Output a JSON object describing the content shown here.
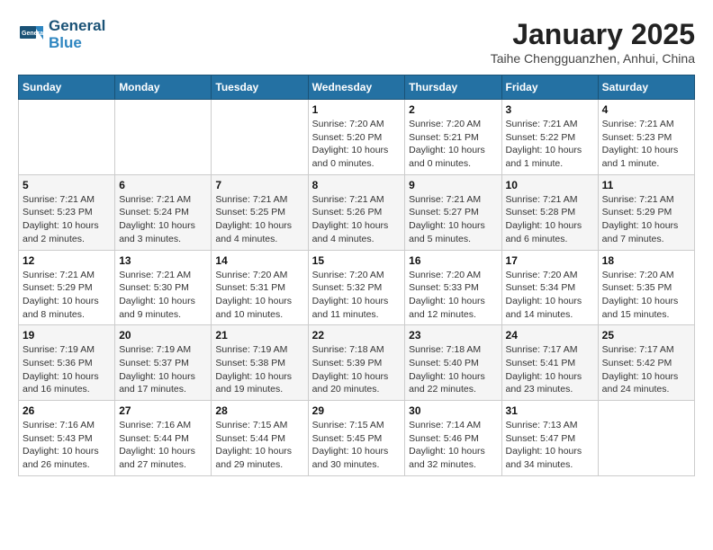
{
  "logo": {
    "line1": "General",
    "line2": "Blue"
  },
  "title": "January 2025",
  "subtitle": "Taihe Chengguanzhen, Anhui, China",
  "days_of_week": [
    "Sunday",
    "Monday",
    "Tuesday",
    "Wednesday",
    "Thursday",
    "Friday",
    "Saturday"
  ],
  "weeks": [
    [
      {
        "day": "",
        "info": ""
      },
      {
        "day": "",
        "info": ""
      },
      {
        "day": "",
        "info": ""
      },
      {
        "day": "1",
        "info": "Sunrise: 7:20 AM\nSunset: 5:20 PM\nDaylight: 10 hours\nand 0 minutes."
      },
      {
        "day": "2",
        "info": "Sunrise: 7:20 AM\nSunset: 5:21 PM\nDaylight: 10 hours\nand 0 minutes."
      },
      {
        "day": "3",
        "info": "Sunrise: 7:21 AM\nSunset: 5:22 PM\nDaylight: 10 hours\nand 1 minute."
      },
      {
        "day": "4",
        "info": "Sunrise: 7:21 AM\nSunset: 5:23 PM\nDaylight: 10 hours\nand 1 minute."
      }
    ],
    [
      {
        "day": "5",
        "info": "Sunrise: 7:21 AM\nSunset: 5:23 PM\nDaylight: 10 hours\nand 2 minutes."
      },
      {
        "day": "6",
        "info": "Sunrise: 7:21 AM\nSunset: 5:24 PM\nDaylight: 10 hours\nand 3 minutes."
      },
      {
        "day": "7",
        "info": "Sunrise: 7:21 AM\nSunset: 5:25 PM\nDaylight: 10 hours\nand 4 minutes."
      },
      {
        "day": "8",
        "info": "Sunrise: 7:21 AM\nSunset: 5:26 PM\nDaylight: 10 hours\nand 4 minutes."
      },
      {
        "day": "9",
        "info": "Sunrise: 7:21 AM\nSunset: 5:27 PM\nDaylight: 10 hours\nand 5 minutes."
      },
      {
        "day": "10",
        "info": "Sunrise: 7:21 AM\nSunset: 5:28 PM\nDaylight: 10 hours\nand 6 minutes."
      },
      {
        "day": "11",
        "info": "Sunrise: 7:21 AM\nSunset: 5:29 PM\nDaylight: 10 hours\nand 7 minutes."
      }
    ],
    [
      {
        "day": "12",
        "info": "Sunrise: 7:21 AM\nSunset: 5:29 PM\nDaylight: 10 hours\nand 8 minutes."
      },
      {
        "day": "13",
        "info": "Sunrise: 7:21 AM\nSunset: 5:30 PM\nDaylight: 10 hours\nand 9 minutes."
      },
      {
        "day": "14",
        "info": "Sunrise: 7:20 AM\nSunset: 5:31 PM\nDaylight: 10 hours\nand 10 minutes."
      },
      {
        "day": "15",
        "info": "Sunrise: 7:20 AM\nSunset: 5:32 PM\nDaylight: 10 hours\nand 11 minutes."
      },
      {
        "day": "16",
        "info": "Sunrise: 7:20 AM\nSunset: 5:33 PM\nDaylight: 10 hours\nand 12 minutes."
      },
      {
        "day": "17",
        "info": "Sunrise: 7:20 AM\nSunset: 5:34 PM\nDaylight: 10 hours\nand 14 minutes."
      },
      {
        "day": "18",
        "info": "Sunrise: 7:20 AM\nSunset: 5:35 PM\nDaylight: 10 hours\nand 15 minutes."
      }
    ],
    [
      {
        "day": "19",
        "info": "Sunrise: 7:19 AM\nSunset: 5:36 PM\nDaylight: 10 hours\nand 16 minutes."
      },
      {
        "day": "20",
        "info": "Sunrise: 7:19 AM\nSunset: 5:37 PM\nDaylight: 10 hours\nand 17 minutes."
      },
      {
        "day": "21",
        "info": "Sunrise: 7:19 AM\nSunset: 5:38 PM\nDaylight: 10 hours\nand 19 minutes."
      },
      {
        "day": "22",
        "info": "Sunrise: 7:18 AM\nSunset: 5:39 PM\nDaylight: 10 hours\nand 20 minutes."
      },
      {
        "day": "23",
        "info": "Sunrise: 7:18 AM\nSunset: 5:40 PM\nDaylight: 10 hours\nand 22 minutes."
      },
      {
        "day": "24",
        "info": "Sunrise: 7:17 AM\nSunset: 5:41 PM\nDaylight: 10 hours\nand 23 minutes."
      },
      {
        "day": "25",
        "info": "Sunrise: 7:17 AM\nSunset: 5:42 PM\nDaylight: 10 hours\nand 24 minutes."
      }
    ],
    [
      {
        "day": "26",
        "info": "Sunrise: 7:16 AM\nSunset: 5:43 PM\nDaylight: 10 hours\nand 26 minutes."
      },
      {
        "day": "27",
        "info": "Sunrise: 7:16 AM\nSunset: 5:44 PM\nDaylight: 10 hours\nand 27 minutes."
      },
      {
        "day": "28",
        "info": "Sunrise: 7:15 AM\nSunset: 5:44 PM\nDaylight: 10 hours\nand 29 minutes."
      },
      {
        "day": "29",
        "info": "Sunrise: 7:15 AM\nSunset: 5:45 PM\nDaylight: 10 hours\nand 30 minutes."
      },
      {
        "day": "30",
        "info": "Sunrise: 7:14 AM\nSunset: 5:46 PM\nDaylight: 10 hours\nand 32 minutes."
      },
      {
        "day": "31",
        "info": "Sunrise: 7:13 AM\nSunset: 5:47 PM\nDaylight: 10 hours\nand 34 minutes."
      },
      {
        "day": "",
        "info": ""
      }
    ]
  ]
}
